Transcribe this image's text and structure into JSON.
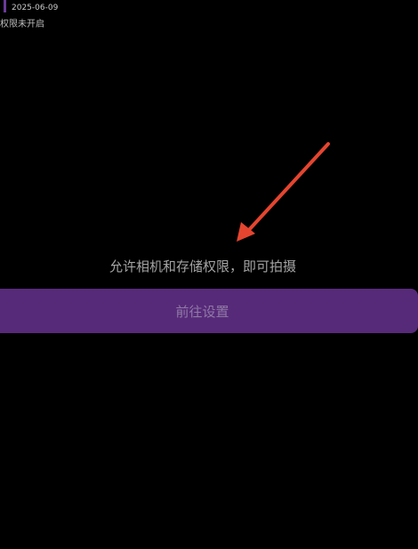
{
  "header": {
    "date": "2025-06-09",
    "permission_status": "权限未开启"
  },
  "main": {
    "message": "允许相机和存储权限，即可拍摄",
    "button_label": "前往设置"
  },
  "colors": {
    "background": "#000000",
    "accent": "#572a79",
    "arrow": "#e5452f"
  },
  "icons": {
    "annotation": "arrow-pointer-icon"
  }
}
